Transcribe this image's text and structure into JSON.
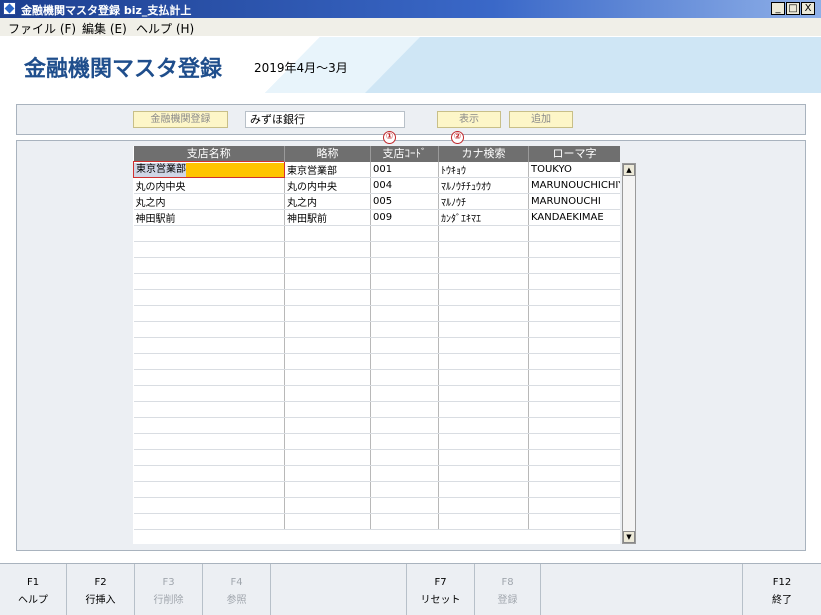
{
  "window": {
    "title": "金融機関マスタ登録 biz_支払計上",
    "controls": [
      "_",
      "□",
      "X"
    ]
  },
  "menu": [
    {
      "label": "ファイル (F)"
    },
    {
      "label": "編集 (E)"
    },
    {
      "label": "ヘルプ (H)"
    }
  ],
  "header": {
    "title": "金融機関マスタ登録",
    "period": "2019年4月～3月"
  },
  "toolbar": {
    "register_bank_label": "金融機関登録",
    "bank_value": "みずほ銀行",
    "display_label": "表示",
    "add_label": "追加"
  },
  "markers": [
    "①",
    "②"
  ],
  "grid": {
    "columns": [
      "支店名称",
      "略称",
      "支店ｺｰﾄﾞ",
      "カナ検索",
      "ローマ字"
    ],
    "rows": [
      [
        "東京営業部",
        "東京営業部",
        "001",
        "ﾄｳｷｮｳ",
        "TOUKYO"
      ],
      [
        "丸の内中央",
        "丸の内中央",
        "004",
        "ﾏﾙﾉｳﾁﾁｭｳｵｳ",
        "MARUNOUCHICHIYU"
      ],
      [
        "丸之内",
        "丸之内",
        "005",
        "ﾏﾙﾉｳﾁ",
        "MARUNOUCHI"
      ],
      [
        "神田駅前",
        "神田駅前",
        "009",
        "ｶﾝﾀﾞｴｷﾏｴ",
        "KANDAEKIMAE"
      ]
    ]
  },
  "fkeys": [
    {
      "key": "F1",
      "label": "ヘルプ",
      "enabled": true
    },
    {
      "key": "F2",
      "label": "行挿入",
      "enabled": true
    },
    {
      "key": "F3",
      "label": "行削除",
      "enabled": false
    },
    {
      "key": "F4",
      "label": "参照",
      "enabled": false
    },
    {
      "key": "",
      "label": "",
      "enabled": false
    },
    {
      "key": "F7",
      "label": "リセット",
      "enabled": true
    },
    {
      "key": "F8",
      "label": "登録",
      "enabled": false
    },
    {
      "key": "",
      "label": "",
      "enabled": false
    },
    {
      "key": "F12",
      "label": "終了",
      "enabled": true
    }
  ]
}
